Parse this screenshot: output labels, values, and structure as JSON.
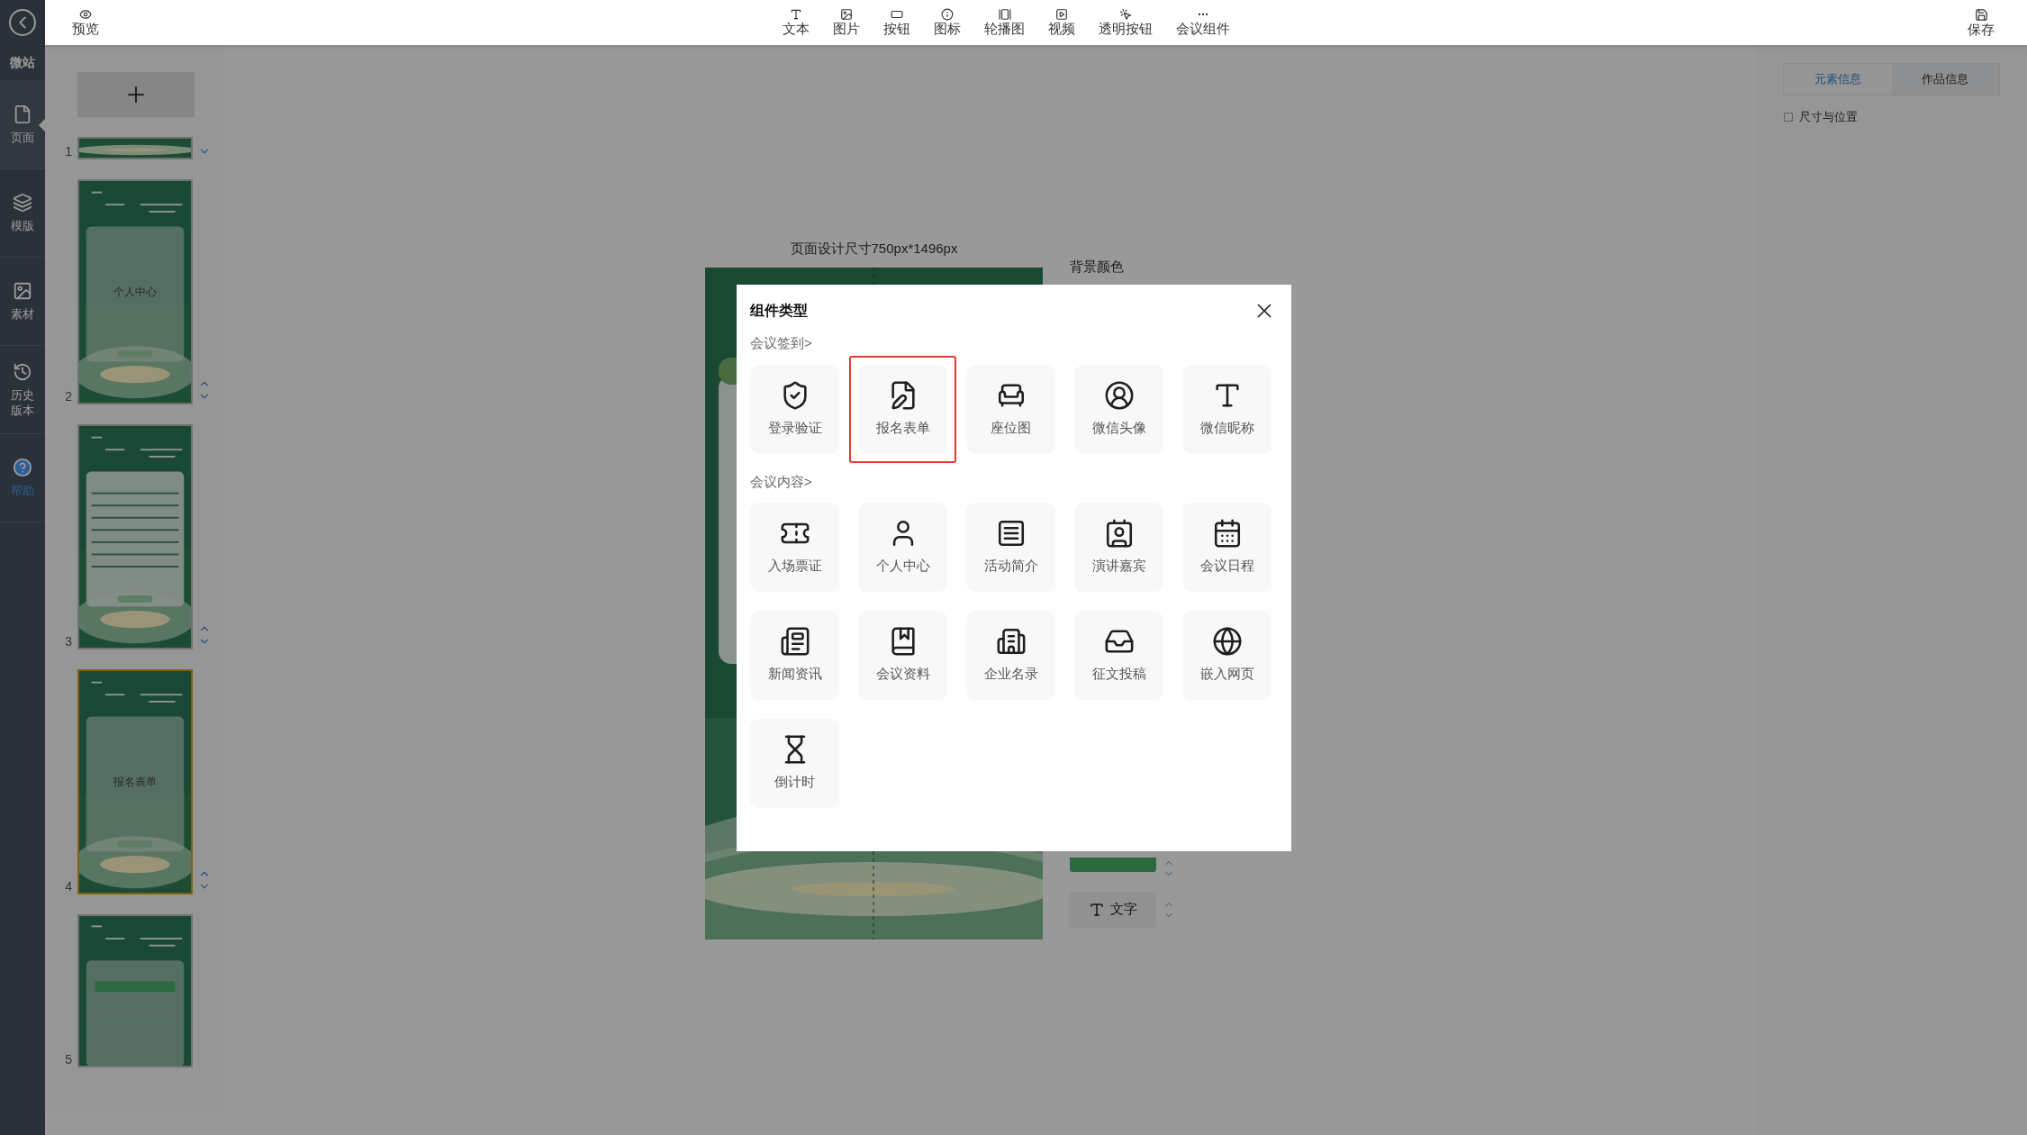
{
  "sidebar": {
    "title": "微站",
    "items": [
      {
        "label": "页面",
        "selected": true
      },
      {
        "label": "模版",
        "selected": false
      },
      {
        "label": "素材",
        "selected": false
      },
      {
        "label": "历史版本",
        "selected": false
      },
      {
        "label": "帮助",
        "selected": false,
        "kind": "help"
      }
    ]
  },
  "topbar": {
    "preview": "预览",
    "tools": [
      "文本",
      "图片",
      "按钮",
      "图标",
      "轮播图",
      "视频",
      "透明按钮",
      "会议组件"
    ],
    "save": "保存"
  },
  "pages": [
    {
      "number": "1",
      "selected": false,
      "kind": "strip",
      "can_move_up": false,
      "can_move_down": true
    },
    {
      "number": "2",
      "selected": false,
      "kind": "panel",
      "title": "个人中心",
      "can_move_up": true,
      "can_move_down": true
    },
    {
      "number": "3",
      "selected": false,
      "kind": "list",
      "can_move_up": true,
      "can_move_down": true
    },
    {
      "number": "4",
      "selected": true,
      "kind": "panel",
      "title": "报名表单",
      "can_move_up": true,
      "can_move_down": true
    },
    {
      "number": "5",
      "selected": false,
      "kind": "grid"
    }
  ],
  "canvas": {
    "size_label": "页面设计尺寸750px*1496px",
    "background_label": "背景颜色",
    "text_button": "文字"
  },
  "right_panel": {
    "tabs": [
      {
        "label": "元素信息",
        "selected": true
      },
      {
        "label": "作品信息",
        "selected": false
      }
    ],
    "section": "尺寸与位置"
  },
  "dialog": {
    "title": "组件类型",
    "sections": [
      {
        "label": "会议签到>",
        "items": [
          {
            "label": "登录验证",
            "selected": false
          },
          {
            "label": "报名表单",
            "selected": true
          },
          {
            "label": "座位图",
            "selected": false
          },
          {
            "label": "微信头像",
            "selected": false
          },
          {
            "label": "微信昵称",
            "selected": false
          }
        ]
      },
      {
        "label": "会议内容>",
        "items": [
          {
            "label": "入场票证",
            "selected": false
          },
          {
            "label": "个人中心",
            "selected": false
          },
          {
            "label": "活动简介",
            "selected": false
          },
          {
            "label": "演讲嘉宾",
            "selected": false
          },
          {
            "label": "会议日程",
            "selected": false
          },
          {
            "label": "新闻资讯",
            "selected": false
          },
          {
            "label": "会议资料",
            "selected": false
          },
          {
            "label": "企业名录",
            "selected": false
          },
          {
            "label": "征文投稿",
            "selected": false
          },
          {
            "label": "嵌入网页",
            "selected": false
          },
          {
            "label": "倒计时",
            "selected": false
          }
        ]
      }
    ]
  }
}
